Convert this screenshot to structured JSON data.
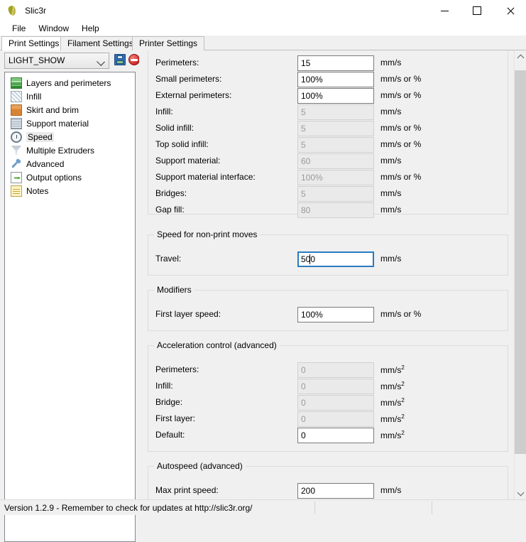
{
  "window": {
    "title": "Slic3r",
    "icon": "slic3r-logo-icon",
    "minimize_label": "–",
    "maximize_label": "□",
    "close_label": "✕"
  },
  "menubar": {
    "items": [
      {
        "label": "File"
      },
      {
        "label": "Window"
      },
      {
        "label": "Help"
      }
    ]
  },
  "tabs": [
    {
      "label": "Print Settings",
      "active": true
    },
    {
      "label": "Filament Settings",
      "active": false
    },
    {
      "label": "Printer Settings",
      "active": false
    }
  ],
  "preset": {
    "selected": "LIGHT_SHOW",
    "save_icon": "floppy-disk-icon",
    "delete_icon": "delete-circle-icon"
  },
  "sidebar": {
    "items": [
      {
        "label": "Layers and perimeters",
        "icon": "layers-icon",
        "selected": false
      },
      {
        "label": "Infill",
        "icon": "infill-hatch-icon",
        "selected": false
      },
      {
        "label": "Skirt and brim",
        "icon": "skirt-box-icon",
        "selected": false
      },
      {
        "label": "Support material",
        "icon": "support-material-icon",
        "selected": false
      },
      {
        "label": "Speed",
        "icon": "speed-clock-icon",
        "selected": true
      },
      {
        "label": "Multiple Extruders",
        "icon": "extruder-funnel-icon",
        "selected": false
      },
      {
        "label": "Advanced",
        "icon": "wrench-icon",
        "selected": false
      },
      {
        "label": "Output options",
        "icon": "output-page-icon",
        "selected": false
      },
      {
        "label": "Notes",
        "icon": "notes-icon",
        "selected": false
      }
    ]
  },
  "groups": [
    {
      "legend": "",
      "legend_visible": false,
      "fields": [
        {
          "label": "Perimeters:",
          "value": "15",
          "unit": "mm/s",
          "unit_sup": "",
          "disabled": false,
          "focused": false
        },
        {
          "label": "Small perimeters:",
          "value": "100%",
          "unit": "mm/s or %",
          "unit_sup": "",
          "disabled": false,
          "focused": false
        },
        {
          "label": "External perimeters:",
          "value": "100%",
          "unit": "mm/s or %",
          "unit_sup": "",
          "disabled": false,
          "focused": false
        },
        {
          "label": "Infill:",
          "value": "5",
          "unit": "mm/s",
          "unit_sup": "",
          "disabled": true,
          "focused": false
        },
        {
          "label": "Solid infill:",
          "value": "5",
          "unit": "mm/s or %",
          "unit_sup": "",
          "disabled": true,
          "focused": false
        },
        {
          "label": "Top solid infill:",
          "value": "5",
          "unit": "mm/s or %",
          "unit_sup": "",
          "disabled": true,
          "focused": false
        },
        {
          "label": "Support material:",
          "value": "60",
          "unit": "mm/s",
          "unit_sup": "",
          "disabled": true,
          "focused": false
        },
        {
          "label": "Support material interface:",
          "value": "100%",
          "unit": "mm/s or %",
          "unit_sup": "",
          "disabled": true,
          "focused": false
        },
        {
          "label": "Bridges:",
          "value": "5",
          "unit": "mm/s",
          "unit_sup": "",
          "disabled": true,
          "focused": false
        },
        {
          "label": "Gap fill:",
          "value": "80",
          "unit": "mm/s",
          "unit_sup": "",
          "disabled": true,
          "focused": false
        }
      ]
    },
    {
      "legend": "Speed for non-print moves",
      "legend_visible": true,
      "fields": [
        {
          "label": "Travel:",
          "value": "500",
          "unit": "mm/s",
          "unit_sup": "",
          "disabled": false,
          "focused": true
        }
      ]
    },
    {
      "legend": "Modifiers",
      "legend_visible": true,
      "fields": [
        {
          "label": "First layer speed:",
          "value": "100%",
          "unit": "mm/s or %",
          "unit_sup": "",
          "disabled": false,
          "focused": false
        }
      ]
    },
    {
      "legend": "Acceleration control (advanced)",
      "legend_visible": true,
      "fields": [
        {
          "label": "Perimeters:",
          "value": "0",
          "unit": "mm/s",
          "unit_sup": "2",
          "disabled": true,
          "focused": false
        },
        {
          "label": "Infill:",
          "value": "0",
          "unit": "mm/s",
          "unit_sup": "2",
          "disabled": true,
          "focused": false
        },
        {
          "label": "Bridge:",
          "value": "0",
          "unit": "mm/s",
          "unit_sup": "2",
          "disabled": true,
          "focused": false
        },
        {
          "label": "First layer:",
          "value": "0",
          "unit": "mm/s",
          "unit_sup": "2",
          "disabled": true,
          "focused": false
        },
        {
          "label": "Default:",
          "value": "0",
          "unit": "mm/s",
          "unit_sup": "2",
          "disabled": false,
          "focused": false
        }
      ]
    },
    {
      "legend": "Autospeed (advanced)",
      "legend_visible": true,
      "fields": [
        {
          "label": "Max print speed:",
          "value": "200",
          "unit": "mm/s",
          "unit_sup": "",
          "disabled": false,
          "focused": false
        }
      ]
    }
  ],
  "scrollbar": {
    "up_icon": "chevron-up-icon",
    "down_icon": "chevron-down-icon"
  },
  "statusbar": {
    "text": "Version 1.2.9 - Remember to check for updates at http://slic3r.org/"
  },
  "colors": {
    "window_bg": "#f0f0f0",
    "panel_bg": "#ffffff",
    "focus_border": "#2a7bc0",
    "disabled_field_bg": "#eaeaea",
    "group_border": "#dcdcdc"
  }
}
